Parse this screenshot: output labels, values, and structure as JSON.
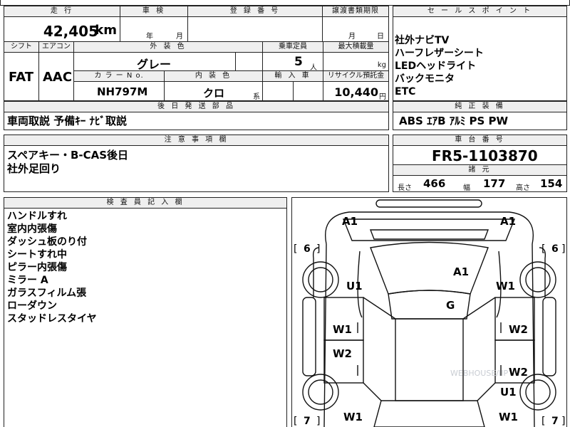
{
  "header": {
    "mileage_label": "走 行",
    "inspection_label": "車 検",
    "registration_label": "登 録 番 号",
    "transfer_label": "譲渡書類期限",
    "sales_point_label": "セ ー ル ス ポ イ ン ト"
  },
  "mileage": {
    "value": "42,405",
    "unit": "km"
  },
  "inspection": {
    "year_unit": "年",
    "month_unit": "月"
  },
  "transfer": {
    "month_unit": "月",
    "day_unit": "日"
  },
  "specs": {
    "shift_label": "シフト",
    "ac_label": "エアコン",
    "exterior_color_label": "外 装 色",
    "capacity_label": "乗車定員",
    "max_load_label": "最大積載量",
    "shift_value": "FAT",
    "ac_value": "AAC",
    "exterior_color_value": "グレー",
    "capacity_value": "5",
    "capacity_unit": "人",
    "max_load_unit": "kg",
    "color_no_label": "カ ラ ー N o.",
    "interior_color_label": "内 装 色",
    "import_label": "輸 入 車",
    "recycle_label": "リサイクル預託金",
    "color_no_value": "NH797M",
    "interior_color_value": "クロ",
    "interior_suffix": "系",
    "recycle_value": "10,440",
    "recycle_unit": "円"
  },
  "sales_points": [
    "社外ナビTV",
    "ハーフレザーシート",
    "LEDヘッドライト",
    "バックモニタ",
    "ETC"
  ],
  "later_parts": {
    "label": "後 日 発 送 部 品",
    "value": "車両取説 予備ｷｰ ﾅﾋﾞ取説"
  },
  "equipment": {
    "label": "純 正 装 備",
    "value": "ABS ｴｱB ｱﾙﾐ PS PW"
  },
  "cautions": {
    "label": "注 意 事 項 欄",
    "lines": [
      "スペアキー・B-CAS後日",
      "社外足回り"
    ]
  },
  "chassis": {
    "label": "車 台 番 号",
    "value": "FR5-1103870"
  },
  "dimensions": {
    "label": "諸 元",
    "length_label": "長さ",
    "length_value": "466",
    "width_label": "幅",
    "width_value": "177",
    "height_label": "高さ",
    "height_value": "154"
  },
  "inspector": {
    "label": "検 査 員 記 入 欄",
    "notes": [
      "ハンドルすれ",
      "室内内張傷",
      "ダッシュ板のり付",
      "シートすれ中",
      "ピラー内張傷",
      "ミラー A",
      "ガラスフィルム張",
      "ローダウン",
      "スタッドレスタイヤ"
    ]
  },
  "diagram": {
    "tire_front_left": "6",
    "tire_front_right": "6",
    "tire_rear_left": "7",
    "tire_rear_right": "7",
    "marks": {
      "a1_front_left": "A1",
      "a1_front_right": "A1",
      "a1_hood": "A1",
      "u1_front_left": "U1",
      "w1_front_right": "W1",
      "g_glass": "G",
      "w1_left_door": "W1",
      "w2_right_door": "W2",
      "w2_left_rear_door": "W2",
      "w2_right_rear_door": "W2",
      "u1_rear_right": "U1",
      "w1_rear_left": "W1",
      "w1_rear_right": "W1"
    },
    "watermark": "WEBHOUSE/IIP"
  }
}
